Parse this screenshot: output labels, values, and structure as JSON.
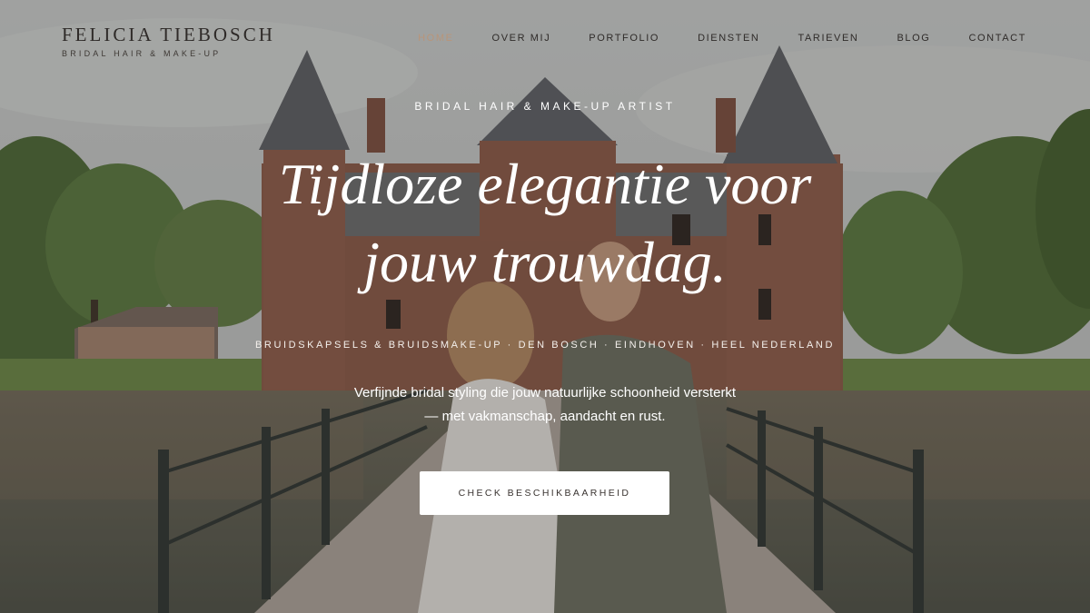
{
  "brand": {
    "name": "FELICIA TIEBOSCH",
    "tagline": "BRIDAL HAIR & MAKE-UP"
  },
  "nav": {
    "items": [
      {
        "label": "HOME",
        "active": true
      },
      {
        "label": "OVER MIJ"
      },
      {
        "label": "PORTFOLIO"
      },
      {
        "label": "DIENSTEN"
      },
      {
        "label": "TARIEVEN"
      },
      {
        "label": "BLOG"
      },
      {
        "label": "CONTACT"
      }
    ],
    "active_color": "#b8957a"
  },
  "hero": {
    "eyebrow": "BRIDAL HAIR & MAKE-UP ARTIST",
    "headline_line1": "Tijdloze elegantie voor",
    "headline_line2": "jouw trouwdag.",
    "locations": "BRUIDSKAPSELS & BRUIDSMAKE-UP · DEN BOSCH · EINDHOVEN · HEEL NEDERLAND",
    "intro_line1": "Verfijnde bridal styling die jouw natuurlijke schoonheid versterkt",
    "intro_line2": "— met vakmanschap, aandacht en rust.",
    "cta_label": "CHECK BESCHIKBAARHEID"
  }
}
